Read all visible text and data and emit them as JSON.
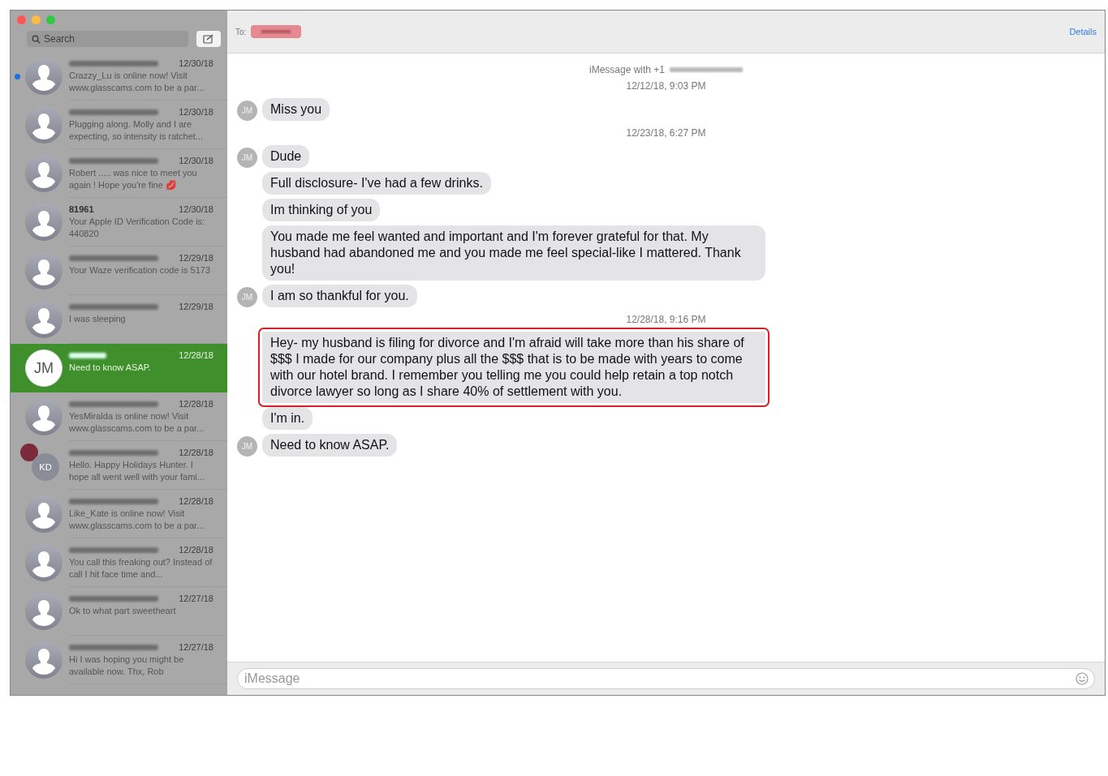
{
  "sidebar": {
    "search": {
      "placeholder": "Search"
    },
    "conversations": [
      {
        "kind": "silhouette",
        "name_blurred": true,
        "date": "12/30/18",
        "preview": "Crazzy_Lu is online now! Visit www.glasscams.com to be a par...",
        "unread": true,
        "selected": false
      },
      {
        "kind": "silhouette",
        "name_blurred": true,
        "date": "12/30/18",
        "preview": "Plugging along. Molly and I are expecting, so intensity is ratchet...",
        "unread": false,
        "selected": false
      },
      {
        "kind": "silhouette",
        "name_blurred": true,
        "date": "12/30/18",
        "preview": "Robert ..... was nice to meet you again ! Hope you're fine 💋",
        "unread": false,
        "selected": false
      },
      {
        "kind": "silhouette",
        "name_blurred": false,
        "name": "81961",
        "date": "12/30/18",
        "preview": "Your Apple ID Verification Code is: 440820",
        "unread": false,
        "selected": false
      },
      {
        "kind": "silhouette",
        "name_blurred": true,
        "date": "12/29/18",
        "preview": "Your Waze verification code is 5173",
        "unread": false,
        "selected": false
      },
      {
        "kind": "silhouette",
        "name_blurred": true,
        "date": "12/29/18",
        "preview": "I was sleeping",
        "unread": false,
        "selected": false
      },
      {
        "kind": "initials",
        "initials": "JM",
        "name_blurred": true,
        "date": "12/28/18",
        "preview": "Need to know ASAP.",
        "unread": false,
        "selected": true
      },
      {
        "kind": "silhouette",
        "name_blurred": true,
        "date": "12/28/18",
        "preview": "YesMiralda is online now! Visit www.glasscams.com to be a par...",
        "unread": false,
        "selected": false
      },
      {
        "kind": "group",
        "initials": "KD",
        "name_blurred": true,
        "date": "12/28/18",
        "preview": "Hello. Happy Holidays Hunter. I hope all went well with your fami...",
        "unread": false,
        "selected": false
      },
      {
        "kind": "silhouette",
        "name_blurred": true,
        "date": "12/28/18",
        "preview": "Like_Kate is online now! Visit www.glasscams.com to be a par...",
        "unread": false,
        "selected": false
      },
      {
        "kind": "silhouette",
        "name_blurred": true,
        "date": "12/28/18",
        "preview": "You call this freaking out? Instead of call I hit face time and...",
        "unread": false,
        "selected": false
      },
      {
        "kind": "silhouette",
        "name_blurred": true,
        "date": "12/27/18",
        "preview": "Ok to what part sweetheart",
        "unread": false,
        "selected": false
      },
      {
        "kind": "silhouette",
        "name_blurred": true,
        "date": "12/27/18",
        "preview": "Hi I was hoping you might be available now. Thx, Rob",
        "unread": false,
        "selected": false
      }
    ]
  },
  "header": {
    "to_label": "To:",
    "details": "Details"
  },
  "thread": [
    {
      "kind": "header",
      "text": "iMessage with +1"
    },
    {
      "kind": "timestamp",
      "text": "12/12/18, 9:03 PM"
    },
    {
      "kind": "message",
      "text": "Miss you",
      "initials": "JM",
      "avatar": true,
      "highlighted": false
    },
    {
      "kind": "timestamp",
      "text": "12/23/18, 6:27 PM"
    },
    {
      "kind": "message",
      "text": "Dude",
      "initials": "JM",
      "avatar": true,
      "highlighted": false
    },
    {
      "kind": "message",
      "text": "Full disclosure- I've had a few drinks.",
      "avatar": false,
      "highlighted": false
    },
    {
      "kind": "message",
      "text": "Im thinking of you",
      "avatar": false,
      "highlighted": false
    },
    {
      "kind": "message",
      "text": "You made me feel wanted and important and I'm forever grateful for that.  My husband had abandoned me and you made me feel special-like I mattered. Thank you!",
      "avatar": false,
      "highlighted": false
    },
    {
      "kind": "message",
      "text": "I am so thankful for you.",
      "initials": "JM",
      "avatar": true,
      "highlighted": false
    },
    {
      "kind": "timestamp",
      "text": "12/28/18, 9:16 PM"
    },
    {
      "kind": "message",
      "text": "Hey- my husband is filing for divorce and I'm afraid will take more than his share of $$$ I made for our company plus all the $$$ that is to be made with years to come with our hotel brand.  I remember you telling me you could help retain a top notch divorce lawyer so long as I share 40% of settlement with you.",
      "avatar": false,
      "highlighted": true
    },
    {
      "kind": "message",
      "text": "I'm in.",
      "avatar": false,
      "highlighted": false
    },
    {
      "kind": "message",
      "text": "Need to know ASAP.",
      "initials": "JM",
      "avatar": true,
      "highlighted": false
    }
  ],
  "composer": {
    "placeholder": "iMessage"
  }
}
